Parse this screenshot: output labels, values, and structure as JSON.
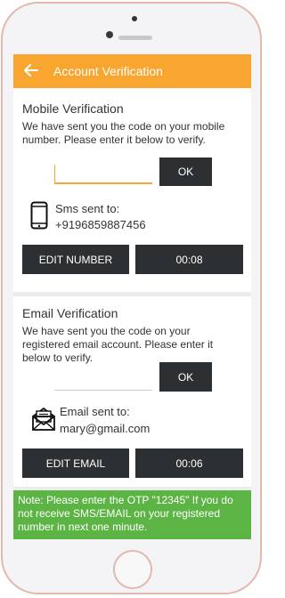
{
  "header": {
    "title": "Account Verification",
    "back_icon": "back-arrow-icon"
  },
  "mobile": {
    "heading": "Mobile Verification",
    "description": "We have sent you the code on your mobile number. Please enter it below to verify.",
    "otp_value": "",
    "ok_label": "OK",
    "sms_label": "Sms sent to:",
    "sms_number": "+9196859887456",
    "edit_label": "EDIT NUMBER",
    "timer": "00:08",
    "icon": "smartphone-icon"
  },
  "email": {
    "heading": "Email Verification",
    "description": "We have sent you the code on your registered email account. Please enter it below to verify.",
    "otp_value": "",
    "ok_label": "OK",
    "sent_label": "Email sent to:",
    "address": "mary@gmail.com",
    "edit_label": "EDIT EMAIL",
    "timer": "00:06",
    "icon": "envelope-icon"
  },
  "note": "Note: Please enter the OTP \"12345\" If you do not receive SMS/EMAIL on your registered number in next one minute.",
  "colors": {
    "accent": "#f8a630",
    "button": "#2d3033",
    "note_bg": "#5cb444"
  }
}
